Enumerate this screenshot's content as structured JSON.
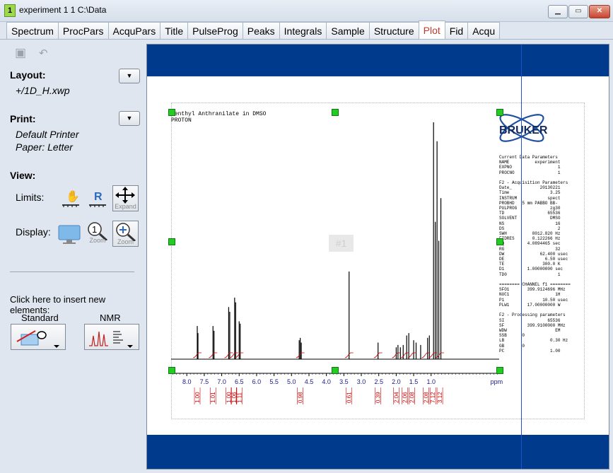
{
  "window": {
    "badge": "1",
    "title": "experiment  1  1  C:\\Data",
    "minimize_icon": "minimize-icon",
    "maximize_icon": "maximize-icon",
    "close_icon": "close-icon"
  },
  "tabs": [
    "Spectrum",
    "ProcPars",
    "AcquPars",
    "Title",
    "PulseProg",
    "Peaks",
    "Integrals",
    "Sample",
    "Structure",
    "Plot",
    "Fid",
    "Acqu"
  ],
  "active_tab": "Plot",
  "left": {
    "layout_label": "Layout:",
    "layout_value": "+/1D_H.xwp",
    "print_label": "Print:",
    "printer": "Default Printer",
    "paper": "Paper: Letter",
    "view_label": "View:",
    "limits_label": "Limits:",
    "limits_r": "R",
    "expand_label": "Expand",
    "display_label": "Display:",
    "zoom1_label": "Zoom",
    "zoom2_label": "Zoom",
    "insert_text": "Click here to insert new elements:",
    "standard_label": "Standard",
    "nmr_label": "NMR"
  },
  "plot": {
    "title_line1": "Menthyl Anthranilate in DMSO",
    "title_line2": "PROTON",
    "ghost_label": "#1",
    "logo_text": "BRUKER",
    "axis_unit": "ppm",
    "colors": {
      "band": "#003a8c",
      "spectrum": "#000000",
      "integral": "#cc0000",
      "handle": "#22cc22",
      "cursor": "#2450c8"
    },
    "params": [
      "Current Data Parameters",
      "NAME          experiment",
      "EXPNO                  1",
      "PROCNO                 1",
      "",
      "F2 - Acquisition Parameters",
      "Date_           20130221",
      "Time                3.25",
      "INSTRUM            spect",
      "PROBHD   5 mm PABBO BB-",
      "PULPROG             zg30",
      "TD                 65536",
      "SOLVENT             DMSO",
      "NS                    16",
      "DS                     2",
      "SWH          8012.820 Hz",
      "FIDRES       0.122266 Hz",
      "AQ         4.0894465 sec",
      "RG                    32",
      "DW              62.400 usec",
      "DE                6.50 usec",
      "TE               300.0 K",
      "D1         1.00000000 sec",
      "TD0                    1",
      "",
      "======== CHANNEL f1 ========",
      "SFO1       399.9124696 MHz",
      "NUC1                  1H",
      "P1               10.50 usec",
      "PLW1       17.00000000 W",
      "",
      "F2 - Processing parameters",
      "SI                 65536",
      "SF         399.9100000 MHz",
      "WDW                   EM",
      "SSB      0",
      "LB                  0.30 Hz",
      "GB       0",
      "PC                  1.00"
    ]
  },
  "chart_data": {
    "type": "line",
    "title": "Menthyl Anthranilate in DMSO",
    "subtitle": "PROTON",
    "xlabel": "ppm",
    "xlim": [
      8.45,
      -0.95
    ],
    "x_ticks": [
      "8.0",
      "7.5",
      "7.0",
      "6.5",
      "6.0",
      "5.5",
      "5.0",
      "4.5",
      "4.0",
      "3.5",
      "3.0",
      "2.5",
      "2.0",
      "1.5",
      "1.0"
    ],
    "peaks": [
      {
        "ppm": 7.7,
        "height": 0.14
      },
      {
        "ppm": 7.68,
        "height": 0.11
      },
      {
        "ppm": 7.25,
        "height": 0.14
      },
      {
        "ppm": 7.22,
        "height": 0.12
      },
      {
        "ppm": 6.8,
        "height": 0.22
      },
      {
        "ppm": 6.77,
        "height": 0.2
      },
      {
        "ppm": 6.63,
        "height": 0.26
      },
      {
        "ppm": 6.6,
        "height": 0.24
      },
      {
        "ppm": 6.5,
        "height": 0.16
      },
      {
        "ppm": 6.47,
        "height": 0.15
      },
      {
        "ppm": 4.78,
        "height": 0.08
      },
      {
        "ppm": 4.75,
        "height": 0.09
      },
      {
        "ppm": 4.72,
        "height": 0.07
      },
      {
        "ppm": 3.35,
        "height": 0.37
      },
      {
        "ppm": 2.52,
        "height": 0.07
      },
      {
        "ppm": 2.0,
        "height": 0.05
      },
      {
        "ppm": 1.95,
        "height": 0.06
      },
      {
        "ppm": 1.88,
        "height": 0.05
      },
      {
        "ppm": 1.8,
        "height": 0.06
      },
      {
        "ppm": 1.7,
        "height": 0.1
      },
      {
        "ppm": 1.64,
        "height": 0.11
      },
      {
        "ppm": 1.5,
        "height": 0.08
      },
      {
        "ppm": 1.43,
        "height": 0.07
      },
      {
        "ppm": 1.3,
        "height": 0.06
      },
      {
        "ppm": 1.1,
        "height": 0.09
      },
      {
        "ppm": 1.05,
        "height": 0.1
      },
      {
        "ppm": 0.93,
        "height": 1.0
      },
      {
        "ppm": 0.88,
        "height": 0.58
      },
      {
        "ppm": 0.83,
        "height": 0.92
      },
      {
        "ppm": 0.78,
        "height": 0.5
      },
      {
        "ppm": 0.72,
        "height": 0.68
      }
    ],
    "integrals": [
      {
        "ppm": 7.7,
        "label": "1.00"
      },
      {
        "ppm": 7.25,
        "label": "1.01"
      },
      {
        "ppm": 6.8,
        "label": "1.00"
      },
      {
        "ppm": 6.65,
        "label": "1.06"
      },
      {
        "ppm": 6.5,
        "label": "1.11"
      },
      {
        "ppm": 4.75,
        "label": "0.98"
      },
      {
        "ppm": 3.35,
        "label": "0.61"
      },
      {
        "ppm": 2.52,
        "label": "0.39"
      },
      {
        "ppm": 2.0,
        "label": "2.04"
      },
      {
        "ppm": 1.75,
        "label": "2.06"
      },
      {
        "ppm": 1.55,
        "label": "2.08"
      },
      {
        "ppm": 1.15,
        "label": "2.08"
      },
      {
        "ppm": 0.95,
        "label": "7.12"
      },
      {
        "ppm": 0.75,
        "label": "3.12"
      }
    ]
  }
}
